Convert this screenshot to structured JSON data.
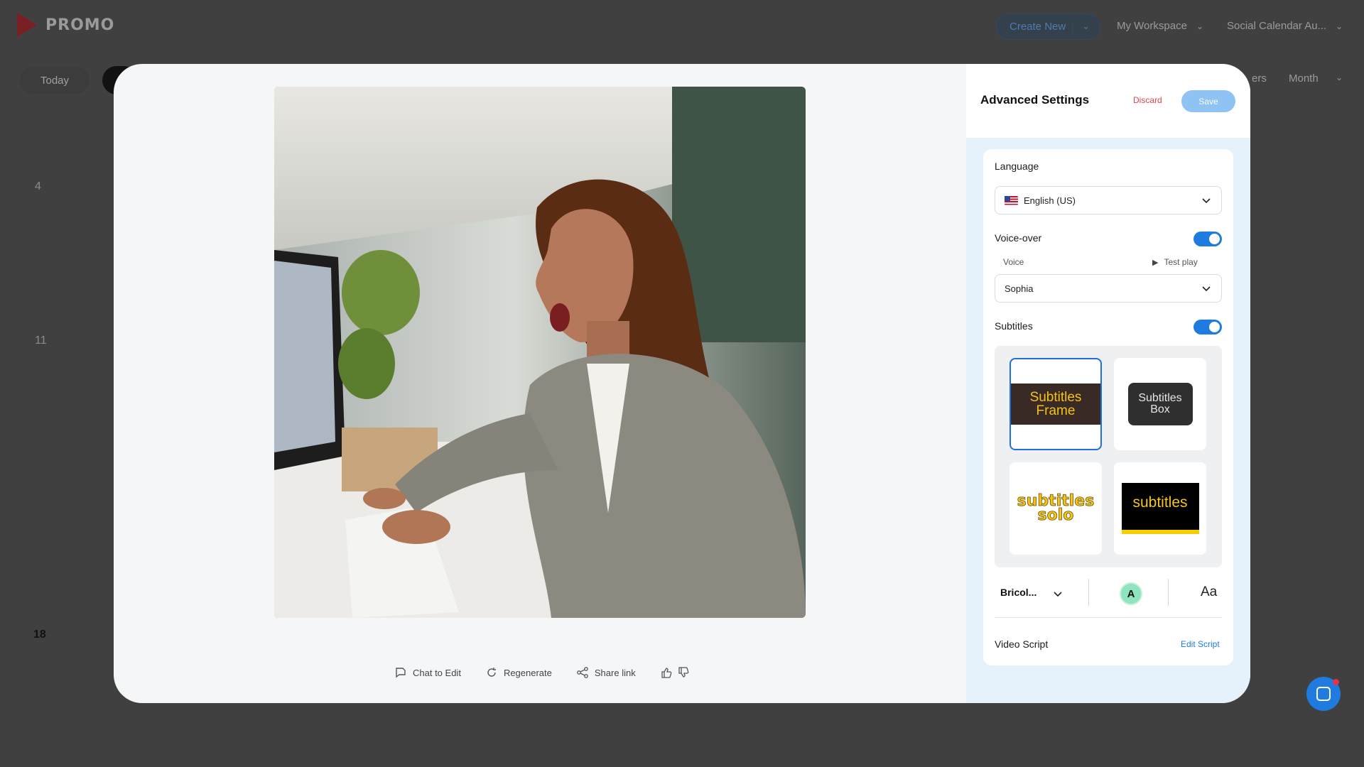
{
  "app": {
    "brand": "PROMO",
    "header": {
      "create_new": "Create New",
      "workspace": "My Workspace",
      "calendar": "Social Calendar Au..."
    },
    "toolbar": {
      "today": "Today",
      "filters_partial": "ers",
      "view": "Month"
    },
    "calendar_days": [
      "4",
      "11",
      "18"
    ]
  },
  "modal": {
    "actions": {
      "chat_to_edit": "Chat to Edit",
      "regenerate": "Regenerate",
      "share_link": "Share link"
    }
  },
  "settings": {
    "title": "Advanced Settings",
    "discard": "Discard",
    "save": "Save",
    "language_label": "Language",
    "language_value": "English (US)",
    "voiceover_label": "Voice-over",
    "voiceover_on": true,
    "voice_label": "Voice",
    "test_play": "Test play",
    "voice_value": "Sophia",
    "subtitles_label": "Subtitles",
    "subtitles_on": true,
    "styles": {
      "frame_line1": "Subtitles",
      "frame_line2": "Frame",
      "box_line1": "Subtitles",
      "box_line2": "Box",
      "solo_line1": "subtitles",
      "solo_line2": "solo",
      "bar": "subtitles"
    },
    "font_value": "Bricol...",
    "color_letter": "A",
    "case_glyph": "Aa",
    "video_script_label": "Video Script",
    "edit_script": "Edit Script"
  },
  "colors": {
    "accent": "#1f7be0",
    "discard": "#e0434f",
    "save_disabled": "#8ec3f4",
    "subtitle_yellow": "#f2c21b"
  }
}
